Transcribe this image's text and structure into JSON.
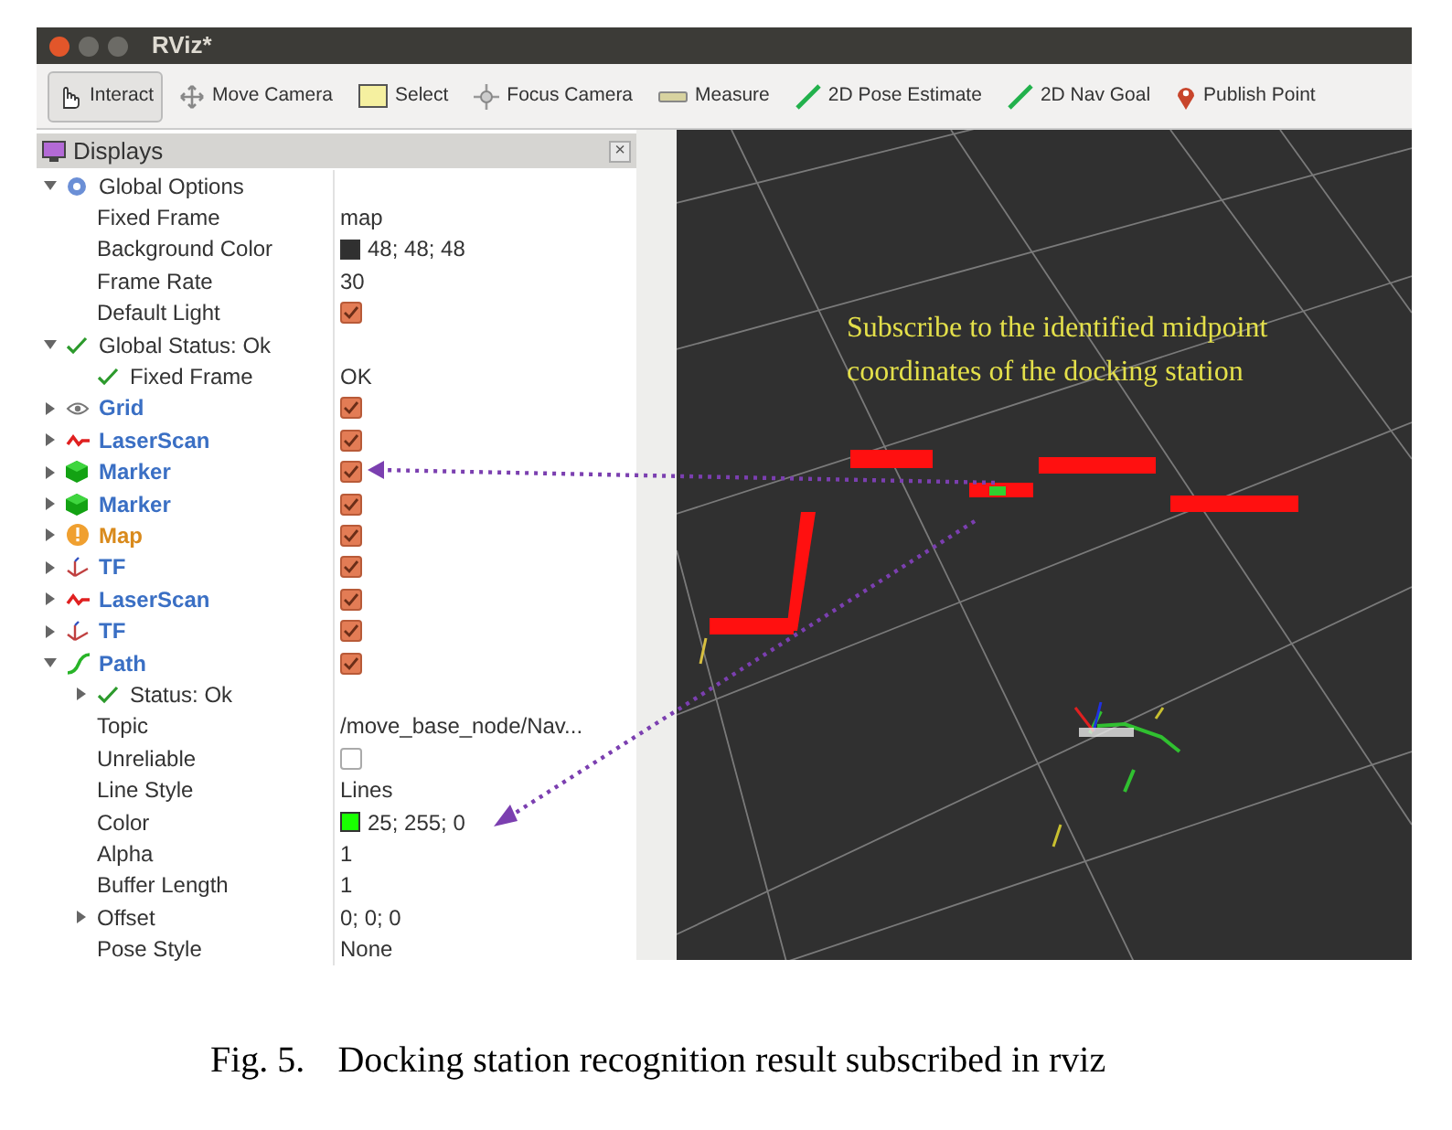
{
  "window": {
    "title": "RViz*"
  },
  "toolbar": {
    "tools": [
      {
        "label": "Interact",
        "kind": "interact",
        "selected": true
      },
      {
        "label": "Move Camera",
        "kind": "move",
        "selected": false
      },
      {
        "label": "Select",
        "kind": "select",
        "selected": false
      },
      {
        "label": "Focus Camera",
        "kind": "focus",
        "selected": false
      },
      {
        "label": "Measure",
        "kind": "measure",
        "selected": false
      },
      {
        "label": "2D Pose Estimate",
        "kind": "pose",
        "selected": false
      },
      {
        "label": "2D Nav Goal",
        "kind": "nav",
        "selected": false
      },
      {
        "label": "Publish Point",
        "kind": "point",
        "selected": false
      }
    ]
  },
  "displays_panel": {
    "title": "Displays",
    "close": "×",
    "tree": [
      {
        "label": "Global Options",
        "kind": "options",
        "expanded": true,
        "children": [
          {
            "label": "Fixed Frame",
            "kind": "property",
            "value": "map"
          },
          {
            "label": "Background Color",
            "kind": "color",
            "value": "48; 48; 48"
          },
          {
            "label": "Frame Rate",
            "kind": "property",
            "value": "30"
          },
          {
            "label": "Default Light",
            "kind": "property",
            "checked": true
          }
        ]
      },
      {
        "label": "Global Status: Ok",
        "kind": "status",
        "expanded": true,
        "children": [
          {
            "label": "Fixed Frame",
            "kind": "status",
            "value": "OK"
          }
        ]
      },
      {
        "label": "Grid",
        "kind": "grid",
        "expanded": false,
        "warning": false,
        "checked": true
      },
      {
        "label": "LaserScan",
        "kind": "laserscan",
        "expanded": false,
        "warning": false,
        "checked": true
      },
      {
        "label": "Marker",
        "kind": "marker",
        "expanded": false,
        "warning": false,
        "checked": true
      },
      {
        "label": "Marker",
        "kind": "marker",
        "expanded": false,
        "warning": false,
        "checked": true
      },
      {
        "label": "Map",
        "kind": "map",
        "expanded": false,
        "warning": true,
        "checked": true
      },
      {
        "label": "TF",
        "kind": "tf",
        "expanded": false,
        "warning": false,
        "checked": true
      },
      {
        "label": "LaserScan",
        "kind": "laserscan",
        "expanded": false,
        "warning": false,
        "checked": true
      },
      {
        "label": "TF",
        "kind": "tf",
        "expanded": false,
        "warning": false,
        "checked": true
      },
      {
        "label": "Path",
        "kind": "path",
        "expanded": true,
        "warning": false,
        "checked": true,
        "children": [
          {
            "label": "Status: Ok",
            "kind": "status",
            "expanded": false
          },
          {
            "label": "Topic",
            "kind": "property",
            "value": "/move_base_node/Nav..."
          },
          {
            "label": "Unreliable",
            "kind": "property",
            "checked": false
          },
          {
            "label": "Line Style",
            "kind": "property",
            "value": "Lines"
          },
          {
            "label": "Color",
            "kind": "color",
            "value": "25; 255; 0"
          },
          {
            "label": "Alpha",
            "kind": "property",
            "value": "1"
          },
          {
            "label": "Buffer Length",
            "kind": "property",
            "value": "1"
          },
          {
            "label": "Offset",
            "kind": "property",
            "expanded": false,
            "value": "0; 0; 0"
          },
          {
            "label": "Pose Style",
            "kind": "property",
            "value": "None"
          }
        ]
      }
    ]
  },
  "viewport": {
    "annotation": "Subscribe to the identified midpoint coordinates of the docking station"
  },
  "figure": {
    "number": "Fig. 5.",
    "caption": "Docking station recognition result subscribed in rviz"
  }
}
